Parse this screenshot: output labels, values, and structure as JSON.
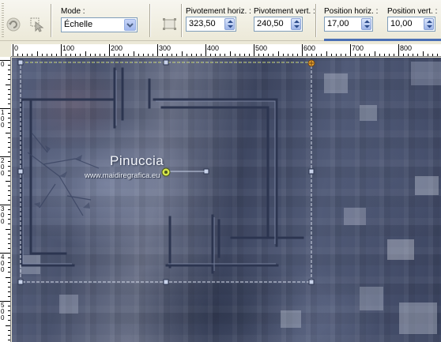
{
  "toolbar": {
    "mode_label": "Mode :",
    "mode_value": "Échelle",
    "pivot_h_label": "Pivotement horiz. :",
    "pivot_h_value": "323,50",
    "pivot_v_label": "Pivotement vert. :",
    "pivot_v_value": "240,50",
    "pos_h_label": "Position horiz. :",
    "pos_h_value": "17,00",
    "pos_v_label": "Position vert. :",
    "pos_v_value": "10,00"
  },
  "ruler_h": [
    "0",
    "100",
    "200",
    "300",
    "400",
    "500",
    "600",
    "700",
    "800"
  ],
  "ruler_v": [
    "0",
    "1 0 0",
    "2 0 0",
    "3 0 0",
    "4 0 0",
    "5 0 0"
  ],
  "watermark": {
    "brand": "Pinuccia",
    "site": "www.maidiregrafica.eu"
  },
  "colors": {
    "accent": "#4a6fb5",
    "handle": "#c9d3ea",
    "pivot": "#d7e84a"
  },
  "icons": [
    "undo-arrow-icon",
    "pointer-select-icon",
    "reset-deform-icon",
    "chevron-down-icon",
    "spin-arrows-icon"
  ]
}
